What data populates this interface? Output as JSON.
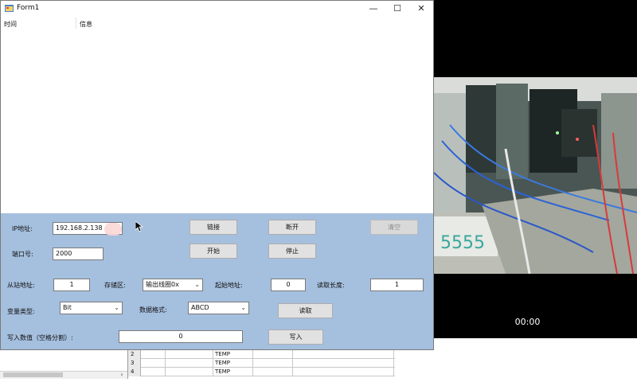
{
  "window": {
    "title": "Form1",
    "controls": {
      "minimize": "—",
      "maximize": "☐",
      "close": "✕"
    }
  },
  "listview": {
    "columns": [
      "时间",
      "信息"
    ]
  },
  "connection": {
    "ip_label": "IP地址:",
    "ip_value": "192.168.2.138",
    "port_label": "端口号:",
    "port_value": "2000",
    "connect_button": "链接",
    "disconnect_button": "断开",
    "clear_button": "清空",
    "start_button": "开始",
    "stop_button": "停止"
  },
  "read_params": {
    "slave_label": "从站地址:",
    "slave_value": "1",
    "area_label": "存储区:",
    "area_value": "输出线圈0x",
    "start_label": "起始地址:",
    "start_value": "0",
    "length_label": "读取长度:",
    "length_value": "1",
    "vartype_label": "变量类型:",
    "vartype_value": "Bit",
    "format_label": "数据格式:",
    "format_value": "ABCD",
    "read_button": "读取"
  },
  "write": {
    "label": "写入数值（空格分割）:",
    "value": "0",
    "button": "写入"
  },
  "sheet": {
    "rows": [
      {
        "num": "2",
        "text": "TEMP"
      },
      {
        "num": "3",
        "text": "TEMP"
      },
      {
        "num": "4",
        "text": "TEMP"
      }
    ]
  },
  "video": {
    "timecode": "00:00"
  }
}
